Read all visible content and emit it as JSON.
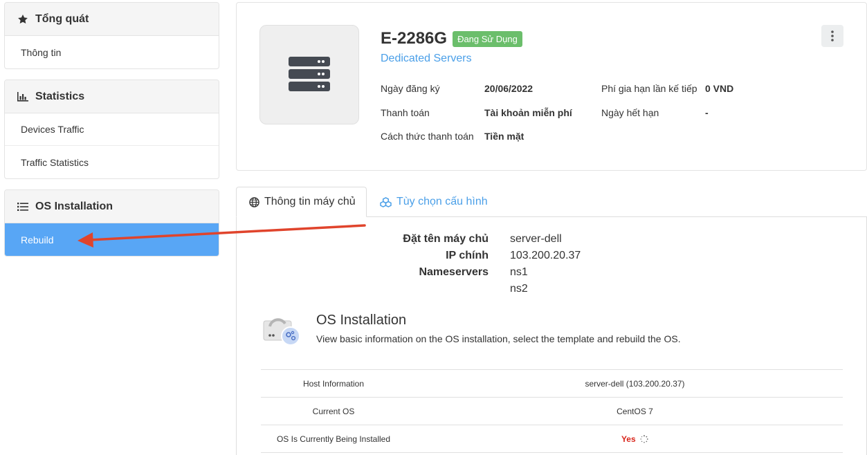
{
  "sidebar": {
    "overview": {
      "title": "Tổng quát",
      "icon": "star-icon",
      "items": [
        "Thông tin"
      ]
    },
    "statistics": {
      "title": "Statistics",
      "icon": "bar-chart-icon",
      "items": [
        "Devices Traffic",
        "Traffic Statistics"
      ]
    },
    "os_installation": {
      "title": "OS Installation",
      "icon": "list-icon",
      "items": [
        "Rebuild"
      ],
      "active_item": "Rebuild"
    }
  },
  "product": {
    "name": "E-2286G",
    "status": "Đang Sử Dụng",
    "group": "Dedicated Servers",
    "image_icon": "server-icon",
    "fields": {
      "reg_date_label": "Ngày đăng ký",
      "reg_date_value": "20/06/2022",
      "payment_label": "Thanh toán",
      "payment_value": "Tài khoản miễn phí",
      "method_label": "Cách thức thanh toán",
      "method_value": "Tiền mặt",
      "renew_label": "Phí gia hạn lần kế tiếp",
      "renew_value": "0 VND",
      "expiry_label": "Ngày hết hạn",
      "expiry_value": "-"
    }
  },
  "tabs": [
    {
      "label": "Thông tin máy chủ",
      "icon": "globe-icon",
      "active": true
    },
    {
      "label": "Tùy chọn cấu hình",
      "icon": "cubes-icon",
      "active": false
    }
  ],
  "server_info": {
    "hostname_label": "Đặt tên máy chủ",
    "hostname_value": "server-dell",
    "ip_label": "IP chính",
    "ip_value": "103.200.20.37",
    "ns_label": "Nameservers",
    "ns1": "ns1",
    "ns2": "ns2"
  },
  "os_section": {
    "title": "OS Installation",
    "description": "View basic information on the OS installation, select the template and rebuild the OS.",
    "rows": [
      {
        "label": "Host Information",
        "value": "server-dell (103.200.20.37)"
      },
      {
        "label": "Current OS",
        "value": "CentOS 7"
      },
      {
        "label": "OS Is Currently Being Installed",
        "value": "Yes"
      }
    ]
  },
  "colors": {
    "accent": "#58a6f5",
    "link": "#4a9fe8",
    "status_green": "#5cb85c",
    "arrow_red": "#e0442c",
    "yes_red": "#d9261c"
  }
}
